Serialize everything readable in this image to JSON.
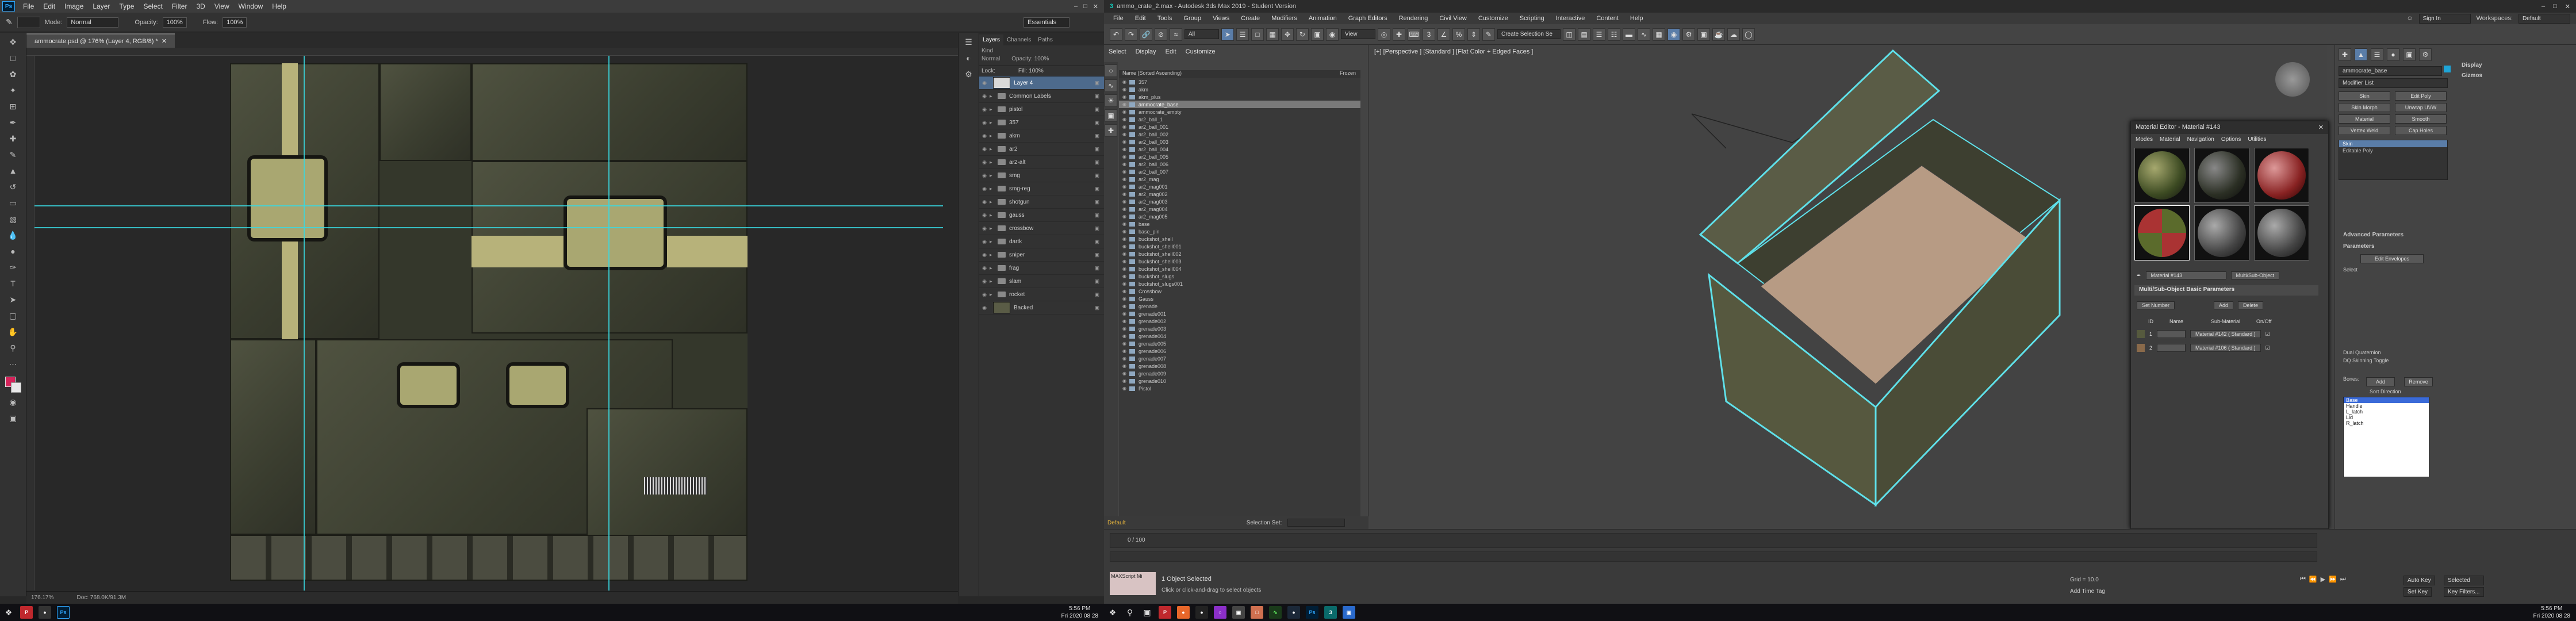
{
  "photoshop": {
    "logo": "Ps",
    "menu": [
      "File",
      "Edit",
      "Image",
      "Layer",
      "Type",
      "Select",
      "Filter",
      "3D",
      "View",
      "Window",
      "Help"
    ],
    "options": {
      "mode_label": "Mode:",
      "mode_value": "Normal",
      "opacity_label": "Opacity:",
      "opacity_value": "100%",
      "flow_label": "Flow:",
      "flow_value": "100%"
    },
    "doc_tab": "ammocrate.psd @ 176% (Layer 4, RGB/8) *",
    "workspace": "Essentials",
    "status": {
      "zoom": "176.17%",
      "doc": "Doc: 768.0K/91.3M"
    },
    "panel_tabs": [
      "Layers",
      "Channels",
      "Paths"
    ],
    "filter": {
      "kind": "Kind",
      "blend": "Normal",
      "opacity": "Opacity: 100%",
      "lock": "Lock:",
      "fill": "Fill: 100%"
    },
    "layers": [
      {
        "name": "Layer 4",
        "type": "layer",
        "selected": true
      },
      {
        "name": "Common Labels",
        "type": "group"
      },
      {
        "name": "pistol",
        "type": "group"
      },
      {
        "name": "357",
        "type": "group"
      },
      {
        "name": "akm",
        "type": "group"
      },
      {
        "name": "ar2",
        "type": "group"
      },
      {
        "name": "ar2-alt",
        "type": "group"
      },
      {
        "name": "smg",
        "type": "group"
      },
      {
        "name": "smg-reg",
        "type": "group"
      },
      {
        "name": "shotgun",
        "type": "group"
      },
      {
        "name": "gauss",
        "type": "group"
      },
      {
        "name": "crossbow",
        "type": "group"
      },
      {
        "name": "dartk",
        "type": "group"
      },
      {
        "name": "sniper",
        "type": "group"
      },
      {
        "name": "frag",
        "type": "group"
      },
      {
        "name": "slam",
        "type": "group"
      },
      {
        "name": "rocket",
        "type": "group"
      },
      {
        "name": "Backed",
        "type": "layer"
      }
    ]
  },
  "max": {
    "title": "ammo_crate_2.max - Autodesk 3ds Max 2019 - Student Version",
    "signin": "Sign In",
    "workspace_label": "Workspaces:",
    "workspace_value": "Default",
    "menu": [
      "File",
      "Edit",
      "Tools",
      "Group",
      "Views",
      "Create",
      "Modifiers",
      "Animation",
      "Graph Editors",
      "Rendering",
      "Civil View",
      "Customize",
      "Scripting",
      "Interactive",
      "Content",
      "Help"
    ],
    "toolbar": {
      "filter": "All",
      "view": "View",
      "selset": "Create Selection Se"
    },
    "scene_menu": [
      "Select",
      "Display",
      "Edit",
      "Customize"
    ],
    "scene_header": "Name (Sorted Ascending)",
    "scene_header2": "Frozen",
    "scene_items": [
      "357",
      "akm",
      "akm_plus",
      "ammocrate_base",
      "ammocrate_empty",
      "ar2_ball_1",
      "ar2_ball_001",
      "ar2_ball_002",
      "ar2_ball_003",
      "ar2_ball_004",
      "ar2_ball_005",
      "ar2_ball_006",
      "ar2_ball_007",
      "ar2_mag",
      "ar2_mag001",
      "ar2_mag002",
      "ar2_mag003",
      "ar2_mag004",
      "ar2_mag005",
      "base",
      "base_pin",
      "buckshot_shell",
      "buckshot_shell001",
      "buckshot_shell002",
      "buckshot_shell003",
      "buckshot_shell004",
      "buckshot_slugs",
      "buckshot_slugs001",
      "Crossbow",
      "Gauss",
      "grenade",
      "grenade001",
      "grenade002",
      "grenade003",
      "grenade004",
      "grenade005",
      "grenade006",
      "grenade007",
      "grenade008",
      "grenade009",
      "grenade010",
      "Pistol"
    ],
    "selected_item": "ammocrate_base",
    "viewport_label": "[+] [Perspective ] [Standard ] [Flat Color + Edged Faces ]",
    "layer_default": "Default",
    "selection_set": "Selection Set:",
    "frame": "0 / 100",
    "status1": "1 Object Selected",
    "status2": "Click or click-and-drag to select objects",
    "maxscript": "MAXScript Mi",
    "grid": "Grid = 10.0",
    "addtime": "Add Time Tag",
    "autokey": "Auto Key",
    "setkey": "Set Key",
    "selected": "Selected",
    "keyfilters": "Key Filters...",
    "cmd": {
      "object_name": "ammocrate_base",
      "modifier_list": "Modifier List",
      "buttons": [
        "Skin",
        "Edit Poly",
        "Skin Morph",
        "Unwrap UVW",
        "Material",
        "Smooth",
        "Vertex Weld",
        "Cap Holes"
      ],
      "stack": [
        "Skin",
        "Editable Poly"
      ],
      "display": "Display",
      "gizmos": "Gizmos",
      "adv": "Advanced Parameters",
      "params": "Parameters",
      "edit_env": "Edit Envelopes",
      "select": "Select",
      "dq": "Dual Quaternion",
      "dq_toggle": "DQ Skinning Toggle",
      "bones": "Bones:",
      "add": "Add",
      "remove": "Remove",
      "sort": "Sort Direction",
      "bone_list": [
        "Base",
        "Handle",
        "L_latch",
        "Lid",
        "R_latch"
      ]
    },
    "mat_editor": {
      "title": "Material Editor - Material #143",
      "menu": [
        "Modes",
        "Material",
        "Navigation",
        "Options",
        "Utilities"
      ],
      "mat_name": "Material #143",
      "mat_type": "Multi/Sub-Object",
      "section": "Multi/Sub-Object Basic Parameters",
      "set_number": "Set Number",
      "add": "Add",
      "delete": "Delete",
      "col_id": "ID",
      "col_name": "Name",
      "col_sub": "Sub-Material",
      "col_onoff": "On/Off",
      "rows": [
        {
          "id": "1",
          "sub": "Material #142 ( Standard )"
        },
        {
          "id": "2",
          "sub": "Material #106 ( Standard )"
        }
      ]
    }
  },
  "taskbar": {
    "left_time": "5:56 PM",
    "left_date": "Fri 2020 08 28",
    "right_time": "5:56 PM",
    "right_date": "Fri 2020 08 28"
  }
}
